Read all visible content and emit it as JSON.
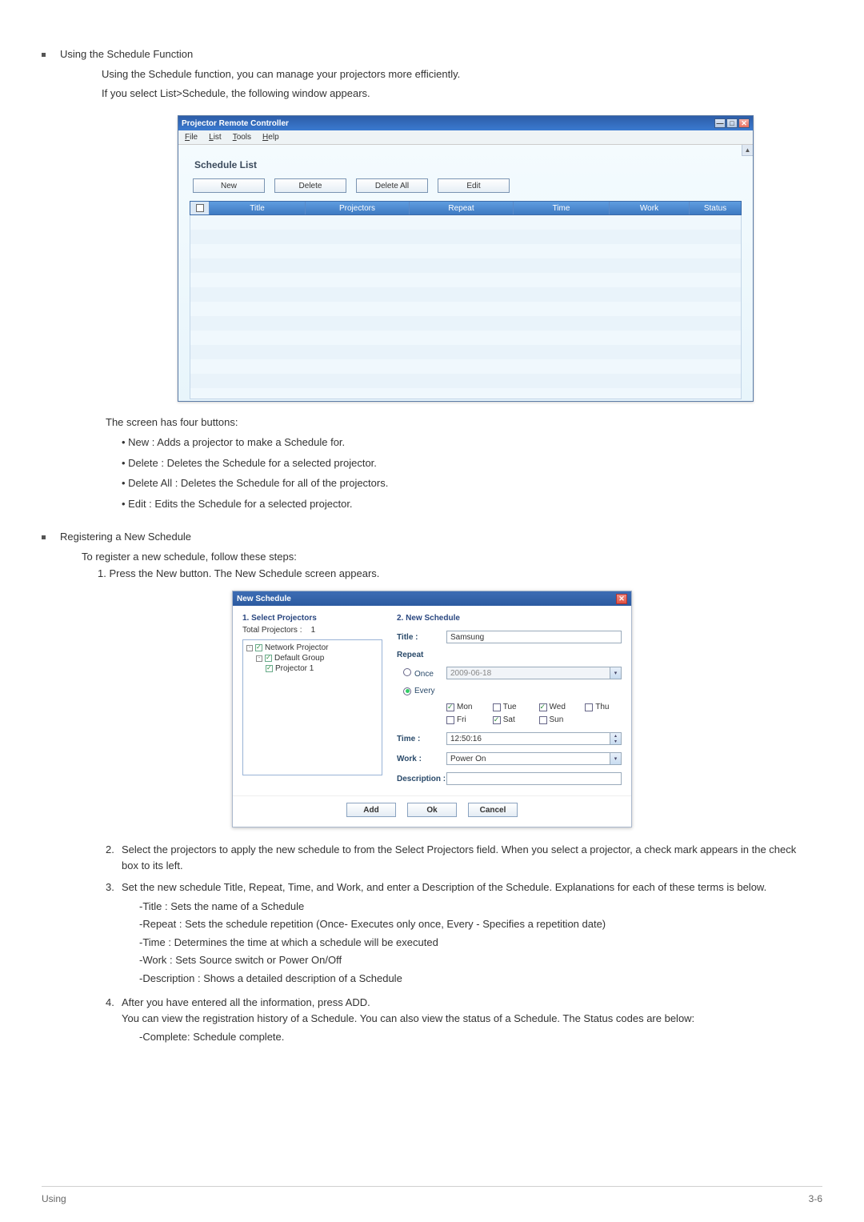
{
  "section1": {
    "title": "Using the Schedule Function",
    "line1": "Using the Schedule function, you can manage your projectors more efficiently.",
    "line2": "If you select  List>Schedule, the following window appears."
  },
  "shot1": {
    "window_title": "Projector Remote Controller",
    "menu": {
      "file": "File",
      "list": "List",
      "tools": "Tools",
      "help": "Help"
    },
    "heading": "Schedule List",
    "buttons": {
      "new": "New",
      "delete": "Delete",
      "delete_all": "Delete All",
      "edit": "Edit"
    },
    "cols": {
      "title": "Title",
      "projectors": "Projectors",
      "repeat": "Repeat",
      "time": "Time",
      "work": "Work",
      "status": "Status"
    }
  },
  "after1": {
    "intro": "The screen has four buttons:",
    "b1": "• New : Adds a projector to make a Schedule for.",
    "b2": "• Delete : Deletes the Schedule for a selected projector.",
    "b3": "• Delete All : Deletes the Schedule for all of the projectors.",
    "b4": "• Edit : Edits the Schedule for a selected projector."
  },
  "section2": {
    "title": "Registering a New Schedule",
    "line1": "To register a new schedule, follow these steps:",
    "step1": "1. Press the New button. The New Schedule screen appears."
  },
  "shot2": {
    "title": "New Schedule",
    "left_hdr": "1. Select Projectors",
    "total_label": "Total Projectors :",
    "total_val": "1",
    "tree": {
      "root": "Network Projector",
      "group": "Default Group",
      "proj": "Projector 1"
    },
    "right_hdr": "2. New Schedule",
    "labels": {
      "title": "Title :",
      "repeat": "Repeat",
      "once": "Once",
      "every": "Every",
      "time": "Time :",
      "work": "Work :",
      "desc": "Description :"
    },
    "values": {
      "title": "Samsung",
      "date": "2009-06-18",
      "time": "12:50:16",
      "work": "Power On"
    },
    "days": {
      "mon": "Mon",
      "tue": "Tue",
      "wed": "Wed",
      "thu": "Thu",
      "fri": "Fri",
      "sat": "Sat",
      "sun": "Sun"
    },
    "buttons": {
      "add": "Add",
      "ok": "Ok",
      "cancel": "Cancel"
    }
  },
  "instr": {
    "n2": "2.",
    "t2": "Select the projectors to apply the new schedule to from the Select Projectors field. When you select a projector, a check mark appears in the check box to its left.",
    "n3": "3.",
    "t3": "Set the new schedule Title, Repeat, Time, and Work, and enter a Description of the Schedule. Explanations for each of these terms is below.",
    "d1": "-Title : Sets the name of a Schedule",
    "d2": "-Repeat : Sets the schedule repetition (Once- Executes only once, Every - Specifies a repetition date)",
    "d3": "-Time : Determines the time at which a schedule will be executed",
    "d4": "-Work : Sets Source switch or Power On/Off",
    "d5": "-Description : Shows a detailed description of a Schedule",
    "n4": "4.",
    "t4": "After you have entered all the information, press ADD.",
    "t4b": "You can view the registration history of a Schedule. You can also view the status of a Schedule. The Status codes are below:",
    "d6": "-Complete: Schedule complete."
  },
  "footer": {
    "left": "Using",
    "right": "3-6"
  }
}
